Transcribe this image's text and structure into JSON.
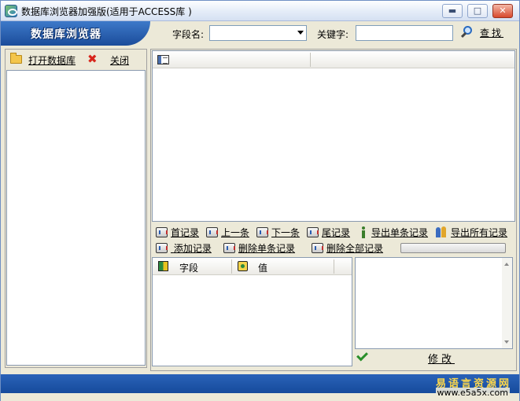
{
  "window": {
    "title": "数据库浏览器加强版(适用于ACCESS库 )",
    "brand": "数据库浏览器",
    "controls": {
      "minimize": "▬",
      "maximize": "□",
      "close": "✕"
    }
  },
  "search": {
    "field_label": "字段名:",
    "field_value": "",
    "keyword_label": "关键字:",
    "keyword_value": "",
    "button_label": "查找"
  },
  "left_toolbar": {
    "open_label": "打开数据库",
    "close_label": "关闭"
  },
  "record_nav": {
    "first": "首记录",
    "prev": "上一条",
    "next": "下一条",
    "last": "尾记录",
    "export_single": "导出单条记录",
    "export_all": "导出所有记录",
    "add": "添加记录",
    "delete_single": "删除单条记录",
    "delete_all": "删除全部记录"
  },
  "detail_table": {
    "col_field": "字段",
    "col_value": "值"
  },
  "modify_label": "修改",
  "watermark": {
    "brand": "易语言资源网",
    "url": "www.e5a5x.com"
  },
  "colors": {
    "accent": "#1b4c9a",
    "title_bar": "#e4ecf8",
    "close_x": "#d7261c"
  }
}
